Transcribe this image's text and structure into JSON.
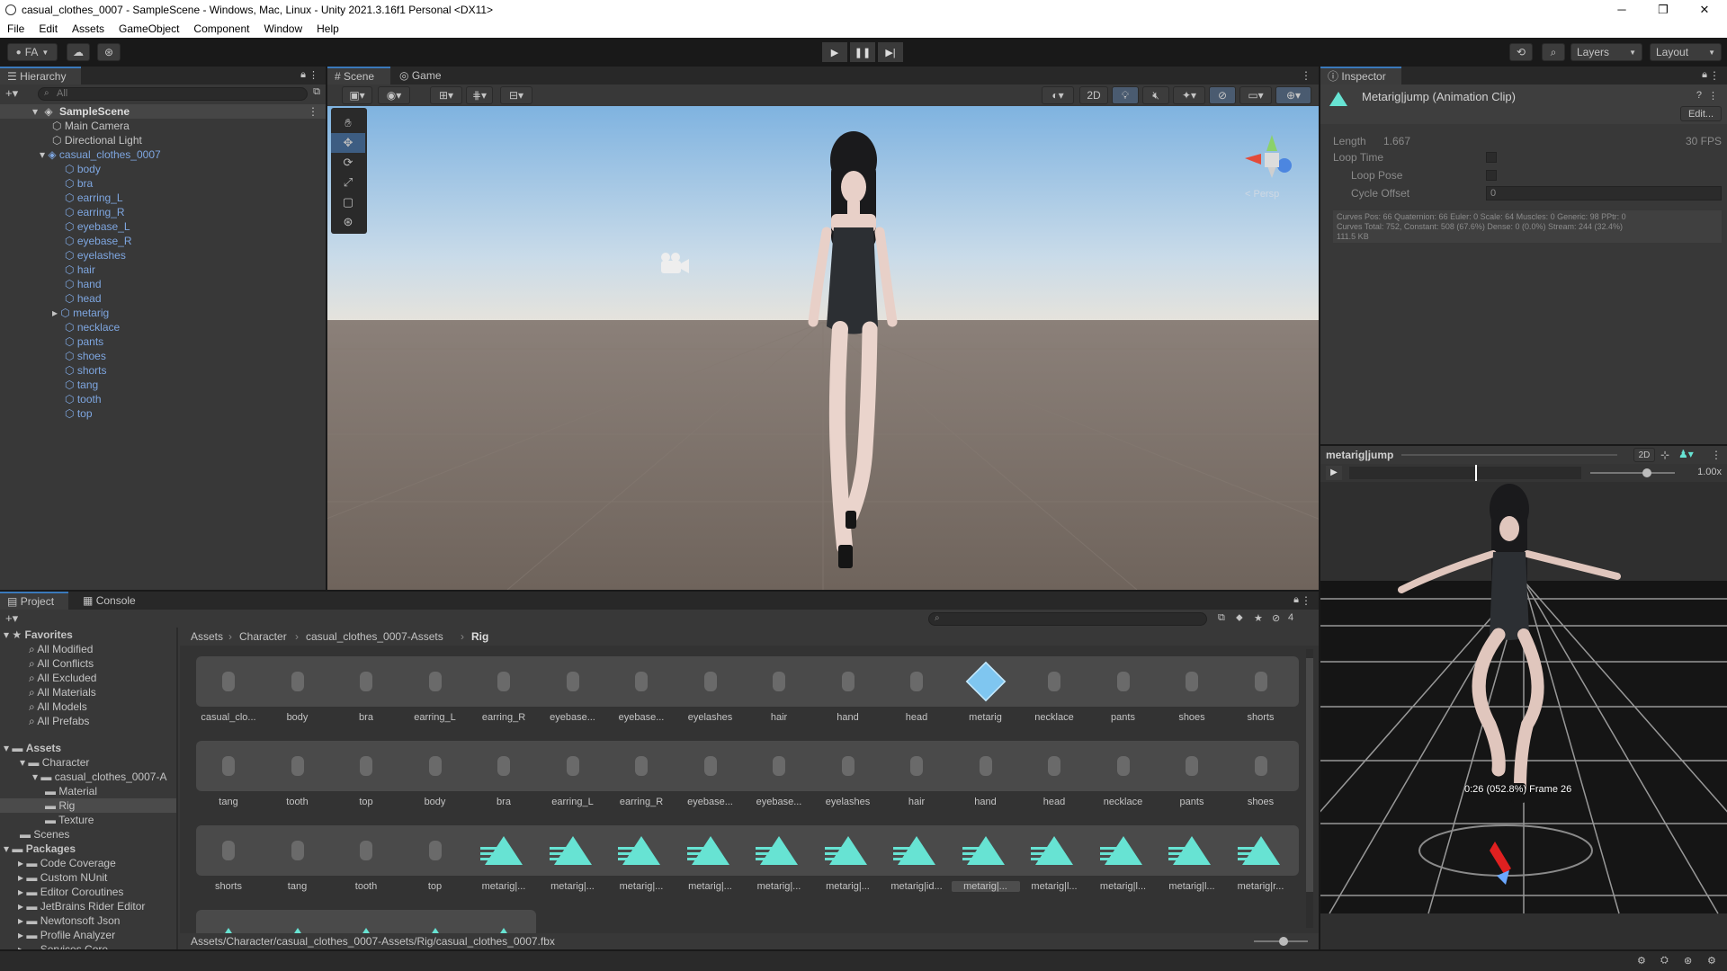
{
  "window": {
    "title": "casual_clothes_0007 - SampleScene - Windows, Mac, Linux - Unity 2021.3.16f1 Personal <DX11>",
    "minimize": "─",
    "maximize": "❐",
    "close": "✕"
  },
  "menu": [
    "File",
    "Edit",
    "Assets",
    "GameObject",
    "Component",
    "Window",
    "Help"
  ],
  "toolbar": {
    "account": "FA",
    "layers": "Layers",
    "layout": "Layout"
  },
  "hierarchy": {
    "tab": "Hierarchy",
    "search_placeholder": "All",
    "scene": "SampleScene",
    "items": [
      {
        "name": "Main Camera",
        "depth": 1,
        "blue": false
      },
      {
        "name": "Directional Light",
        "depth": 1,
        "blue": false
      },
      {
        "name": "casual_clothes_0007",
        "depth": 1,
        "blue": true,
        "expanded": true
      },
      {
        "name": "body",
        "depth": 2,
        "blue": true
      },
      {
        "name": "bra",
        "depth": 2,
        "blue": true
      },
      {
        "name": "earring_L",
        "depth": 2,
        "blue": true
      },
      {
        "name": "earring_R",
        "depth": 2,
        "blue": true
      },
      {
        "name": "eyebase_L",
        "depth": 2,
        "blue": true
      },
      {
        "name": "eyebase_R",
        "depth": 2,
        "blue": true
      },
      {
        "name": "eyelashes",
        "depth": 2,
        "blue": true
      },
      {
        "name": "hair",
        "depth": 2,
        "blue": true
      },
      {
        "name": "hand",
        "depth": 2,
        "blue": true
      },
      {
        "name": "head",
        "depth": 2,
        "blue": true
      },
      {
        "name": "metarig",
        "depth": 2,
        "blue": true,
        "collapsed": true
      },
      {
        "name": "necklace",
        "depth": 2,
        "blue": true
      },
      {
        "name": "pants",
        "depth": 2,
        "blue": true
      },
      {
        "name": "shoes",
        "depth": 2,
        "blue": true
      },
      {
        "name": "shorts",
        "depth": 2,
        "blue": true
      },
      {
        "name": "tang",
        "depth": 2,
        "blue": true
      },
      {
        "name": "tooth",
        "depth": 2,
        "blue": true
      },
      {
        "name": "top",
        "depth": 2,
        "blue": true
      }
    ]
  },
  "scene": {
    "tabs": [
      "Scene",
      "Game"
    ],
    "mode_2d": "2D",
    "gizmo_label": "< Persp"
  },
  "inspector": {
    "tab": "Inspector",
    "title": "Metarig|jump (Animation Clip)",
    "edit_button": "Edit...",
    "length_label": "Length",
    "length_value": "1.667",
    "fps": "30 FPS",
    "loop_time": "Loop Time",
    "loop_pose": "Loop Pose",
    "cycle_offset": "Cycle Offset",
    "cycle_offset_value": "0",
    "curves_line1": "Curves Pos: 66 Quaternion: 66 Euler: 0 Scale: 64 Muscles: 0 Generic: 98 PPtr: 0",
    "curves_line2": "Curves Total: 752, Constant: 508 (67.6%) Dense: 0 (0.0%) Stream: 244 (32.4%)",
    "curves_line3": "111.5 KB"
  },
  "preview": {
    "clip": "metarig|jump",
    "mode_2d": "2D",
    "speed": "1.00x",
    "speed_fraction": 0.67,
    "status": "0:26 (052.8%) Frame 26"
  },
  "project": {
    "tabs": [
      "Project",
      "Console"
    ],
    "asset_count": "4",
    "favorites_label": "Favorites",
    "favorites": [
      "All Modified",
      "All Conflicts",
      "All Excluded",
      "All Materials",
      "All Models",
      "All Prefabs"
    ],
    "assets_label": "Assets",
    "tree": [
      {
        "name": "Character",
        "depth": 1
      },
      {
        "name": "casual_clothes_0007-A",
        "depth": 2
      },
      {
        "name": "Material",
        "depth": 3
      },
      {
        "name": "Rig",
        "depth": 3,
        "selected": true
      },
      {
        "name": "Texture",
        "depth": 3
      },
      {
        "name": "Scenes",
        "depth": 1
      }
    ],
    "packages_label": "Packages",
    "packages": [
      "Code Coverage",
      "Custom NUnit",
      "Editor Coroutines",
      "JetBrains Rider Editor",
      "Newtonsoft Json",
      "Profile Analyzer",
      "Services Core"
    ],
    "breadcrumb": [
      "Assets",
      "Character",
      "casual_clothes_0007-Assets",
      "Rig"
    ],
    "row1": [
      "casual_clo...",
      "body",
      "bra",
      "earring_L",
      "earring_R",
      "eyebase...",
      "eyebase...",
      "eyelashes",
      "hair",
      "hand",
      "head",
      "metarig",
      "necklace",
      "pants",
      "shoes",
      "shorts"
    ],
    "row2": [
      "tang",
      "tooth",
      "top",
      "body",
      "bra",
      "earring_L",
      "earring_R",
      "eyebase...",
      "eyebase...",
      "eyelashes",
      "hair",
      "hand",
      "head",
      "necklace",
      "pants",
      "shoes"
    ],
    "row3": [
      "shorts",
      "tang",
      "tooth",
      "top",
      "metarig|...",
      "metarig|...",
      "metarig|...",
      "metarig|...",
      "metarig|...",
      "metarig|...",
      "metarig|id...",
      "metarig|...",
      "metarig|l...",
      "metarig|l...",
      "metarig|l...",
      "metarig|r..."
    ],
    "path": "Assets/Character/casual_clothes_0007-Assets/Rig/casual_clothes_0007.fbx"
  },
  "colors": {
    "accent": "#3a79bb",
    "anim_icon": "#67e3d3",
    "prefab_blue": "#7ea6e0"
  }
}
